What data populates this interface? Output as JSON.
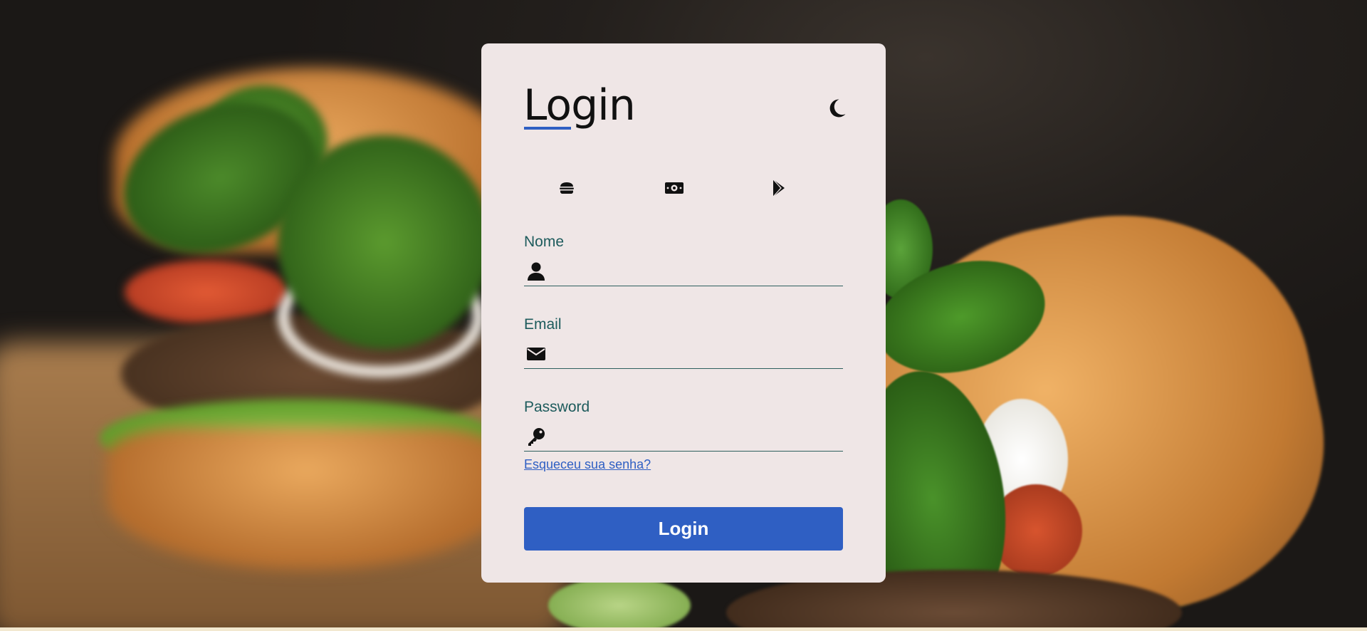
{
  "background": {
    "description_icon": "burger-photo-background"
  },
  "card": {
    "title": "Login",
    "theme_toggle_icon": "moon-icon",
    "accent_color": "#2f5fc3",
    "icons": [
      "burger-icon",
      "money-bill-icon",
      "google-play-icon"
    ],
    "fields": {
      "name": {
        "label": "Nome",
        "icon": "user-icon",
        "value": "",
        "placeholder": ""
      },
      "email": {
        "label": "Email",
        "icon": "envelope-icon",
        "value": "",
        "placeholder": ""
      },
      "password": {
        "label": "Password",
        "icon": "key-icon",
        "value": "",
        "placeholder": ""
      }
    },
    "forgot_link": "Esqueceu sua senha?",
    "submit_label": "Login"
  }
}
